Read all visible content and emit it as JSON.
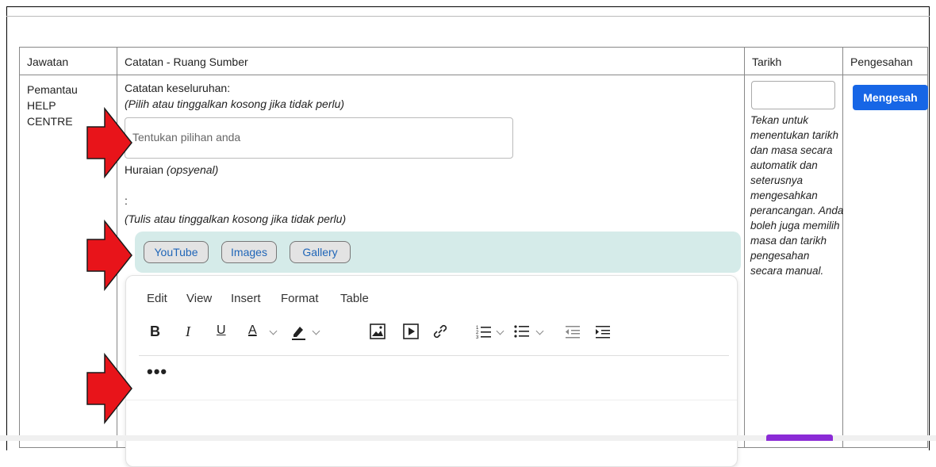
{
  "table": {
    "headers": {
      "position": "Jawatan",
      "notes": "Catatan - Ruang Sumber",
      "date": "Tarikh",
      "approval": "Pengesahan"
    },
    "row": {
      "position": [
        "Pemantau",
        "HELP",
        "CENTRE"
      ],
      "overall_label": "Catatan keseluruhan:",
      "overall_hint": "(Pilih atau tinggalkan kosong jika tidak perlu)",
      "select_placeholder": "Tentukan pilihan anda",
      "desc_label": "Huraian",
      "desc_optional": "(opsyenal)",
      "colon": ":",
      "write_hint": "(Tulis atau tinggalkan kosong jika tidak perlu)",
      "media_buttons": [
        "YouTube",
        "Images",
        "Gallery"
      ],
      "date_hint": "Tekan untuk menentukan tarikh dan masa secara automatik dan seterusnya mengesahkan perancangan. Anda boleh juga memilih masa dan tarikh pengesahan secara manual.",
      "approve_label": "Mengesah"
    }
  },
  "editor": {
    "menu": [
      "Edit",
      "View",
      "Insert",
      "Format",
      "Table"
    ],
    "toolbar_icons": [
      "bold-icon",
      "italic-icon",
      "underline-icon",
      "text-color-icon",
      "highlight-icon",
      "image-icon",
      "media-icon",
      "link-icon",
      "numbered-list-icon",
      "bullet-list-icon",
      "outdent-icon",
      "indent-icon"
    ],
    "more": "•••"
  },
  "colors": {
    "accent": "#1766e6",
    "toolbar_bg": "#d5ebe9",
    "arrow_fill": "#e8141a"
  }
}
